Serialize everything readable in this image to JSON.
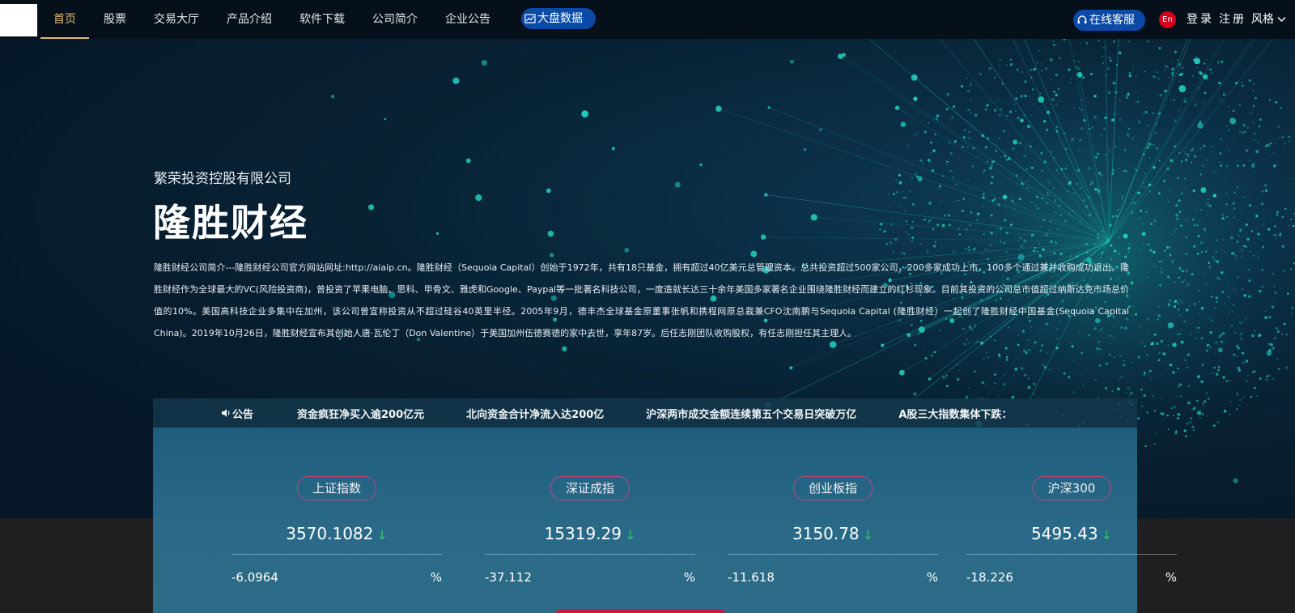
{
  "nav": {
    "items": [
      {
        "label": "首页"
      },
      {
        "label": "股票"
      },
      {
        "label": "交易大厅"
      },
      {
        "label": "产品介绍"
      },
      {
        "label": "软件下载"
      },
      {
        "label": "公司简介"
      },
      {
        "label": "企业公告"
      }
    ],
    "big_data_label": "大盘数据",
    "service_label": "在线客服",
    "lang_label": "En",
    "login_label": "登录",
    "register_label": "注册",
    "style_label": "风格"
  },
  "hero": {
    "company": "繁荣投资控股有限公司",
    "brand": "隆胜财经",
    "intro": "隆胜财经公司简介---隆胜财经公司官方网站网址:http://aiaip.cn。隆胜财经（Sequoia Capital）创始于1972年，共有18只基金，拥有超过40亿美元总管理资本。总共投资超过500家公司，200多家成功上市，100多个通过兼并收购成功退出。隆胜财经作为全球最大的VC(风险投资商)，曾投资了苹果电脑、思科、甲骨文、雅虎和Google、Paypal等一批著名科技公司，一度造就长达三十余年美国多家著名企业围绕隆胜财经而建立的红杉现象。目前其投资的公司总市值超过纳斯达克市场总价值的10%。美国高科技企业多集中在加州，该公司曾宣称投资从不超过硅谷40英里半径。2005年9月，德丰杰全球基金原董事张帆和携程网原总裁兼CFO沈南鹏与Sequoia Capital (隆胜财经）一起创了隆胜财经中国基金(Sequoia Capital China)。2019年10月26日，隆胜财经宣布其创始人唐·瓦伦丁（Don Valentine）于美国加州伍德赛德的家中去世，享年87岁。后任志刚团队收购股权，有任志刚担任其主理人。"
  },
  "notice": {
    "label": "公告",
    "items": [
      "资金疯狂净买入逾200亿元",
      "北向资金合计净流入达200亿",
      "沪深两市成交金额连续第五个交易日突破万亿",
      "A股三大指数集体下跌："
    ]
  },
  "indices": [
    {
      "name": "上证指数",
      "value": "3570.1082",
      "change": "-6.0964",
      "pct": "%"
    },
    {
      "name": "深证成指",
      "value": "15319.29",
      "change": "-37.112",
      "pct": "%"
    },
    {
      "name": "创业板指",
      "value": "3150.78",
      "change": "-11.618",
      "pct": "%"
    },
    {
      "name": "沪深300",
      "value": "5495.43",
      "change": "-18.226",
      "pct": "%"
    }
  ],
  "colors": {
    "accent_gold": "#e6b96b",
    "nav_pill_blue": "#0b4aa6",
    "down_green": "#2ec46b",
    "badge_red": "#d4001a",
    "particle_teal": "#1fd3c2"
  },
  "icons": {
    "big_data": "chart-icon",
    "service": "headset-icon",
    "notice": "speaker-icon",
    "style": "chevron-down-icon",
    "trend": "down-arrow-icon"
  }
}
